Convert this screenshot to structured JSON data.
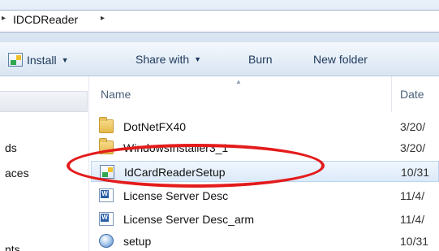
{
  "address": {
    "crumb": "IDCDReader",
    "sep_left": "▸",
    "sep_right": "▸"
  },
  "toolbar": {
    "install": "Install",
    "share_with": "Share with",
    "burn": "Burn",
    "new_folder": "New folder",
    "dropdown_arrow": "▼"
  },
  "nav_pane": {
    "items": [
      "ds",
      "aces",
      "nts"
    ]
  },
  "columns": {
    "name": "Name",
    "date": "Date",
    "sort_arrow": "▲"
  },
  "files": [
    {
      "name": "DotNetFX40",
      "date": "3/20/",
      "icon": "folder-icon"
    },
    {
      "name": "WindowsInstaller3_1",
      "date": "3/20/",
      "icon": "folder-icon"
    },
    {
      "name": "IdCardReaderSetup",
      "date": "10/31",
      "icon": "installer-icon",
      "selected": true
    },
    {
      "name": "License Server Desc",
      "date": "11/4/",
      "icon": "word-document-icon"
    },
    {
      "name": "License Server Desc_arm",
      "date": "11/4/",
      "icon": "word-document-icon"
    },
    {
      "name": "setup",
      "date": "10/31",
      "icon": "setup-icon"
    }
  ],
  "annotation": {
    "color": "#e41b1b",
    "target": "IdCardReaderSetup"
  }
}
